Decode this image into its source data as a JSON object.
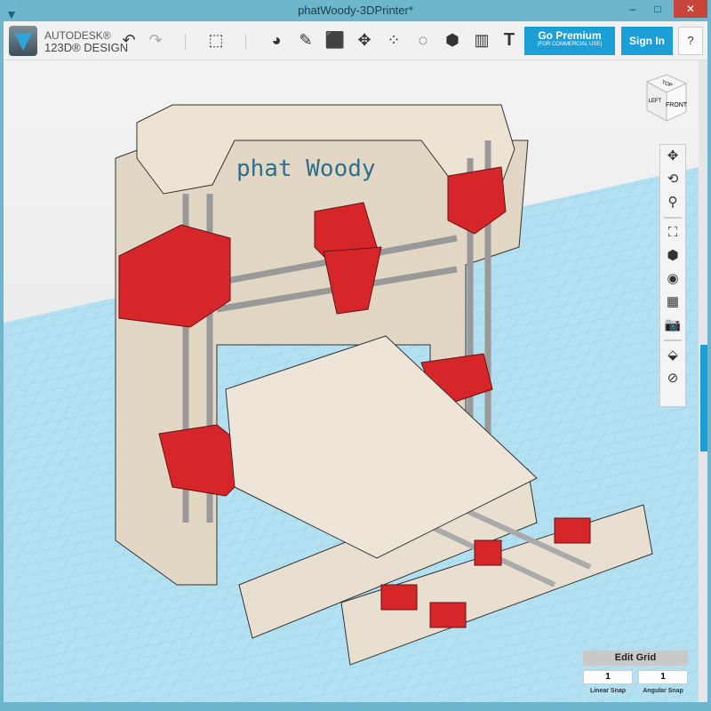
{
  "window": {
    "title": "phatWoody-3DPrinter*",
    "minimize": "–",
    "maximize": "□",
    "close": "✕"
  },
  "brand": {
    "line1": "AUTODESK®",
    "line2": "123D® DESIGN"
  },
  "toolbar": {
    "undo": "↶",
    "redo": "↷",
    "premium_label": "Go Premium",
    "premium_sub": "(FOR COMMERCIAL USE)",
    "signin_label": "Sign In",
    "help_label": "?",
    "text_tool": "T"
  },
  "viewcube": {
    "top": "TOP",
    "left": "LEFT",
    "front": "FRONT"
  },
  "model": {
    "label": "phat Woody"
  },
  "grid": {
    "edit_label": "Edit Grid",
    "linear_snap_value": "1",
    "linear_snap_label": "Linear Snap",
    "angular_snap_value": "1",
    "angular_snap_label": "Angular Snap"
  },
  "colors": {
    "accent": "#1b9fd6",
    "title": "#6db6cc",
    "grid": "#a9dcef",
    "wood": "#e9dfd0",
    "red": "#d6262a"
  }
}
